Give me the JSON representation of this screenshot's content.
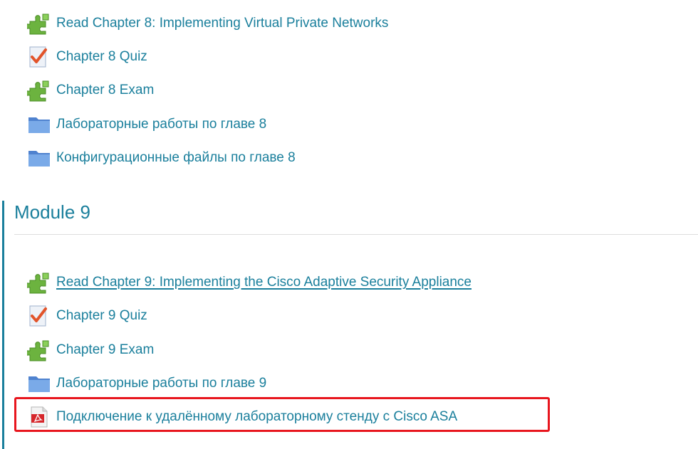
{
  "module8": {
    "items": [
      {
        "label": "Read Chapter 8: Implementing Virtual Private Networks",
        "icon": "puzzle-icon"
      },
      {
        "label": "Chapter 8 Quiz",
        "icon": "quiz-check-icon"
      },
      {
        "label": "Chapter 8 Exam",
        "icon": "puzzle-icon"
      },
      {
        "label": "Лабораторные работы по главе 8",
        "icon": "folder-icon"
      },
      {
        "label": "Конфигурационные файлы по главе 8",
        "icon": "folder-icon"
      }
    ]
  },
  "module9": {
    "title": "Module 9",
    "items": [
      {
        "label": "Read Chapter 9: Implementing the Cisco Adaptive Security Appliance",
        "icon": "puzzle-icon"
      },
      {
        "label": "Chapter 9 Quiz",
        "icon": "quiz-check-icon"
      },
      {
        "label": "Chapter 9 Exam",
        "icon": "puzzle-icon"
      },
      {
        "label": "Лабораторные работы по главе 9",
        "icon": "folder-icon"
      },
      {
        "label": "Подключение к удалённому лабораторному стенду с Cisco ASA",
        "icon": "pdf-icon"
      }
    ]
  },
  "colors": {
    "link": "#1a7f9c",
    "highlight": "#e8161e",
    "puzzle": "#6cb33f",
    "folder": "#5b8fd9",
    "check": "#e2542a"
  }
}
